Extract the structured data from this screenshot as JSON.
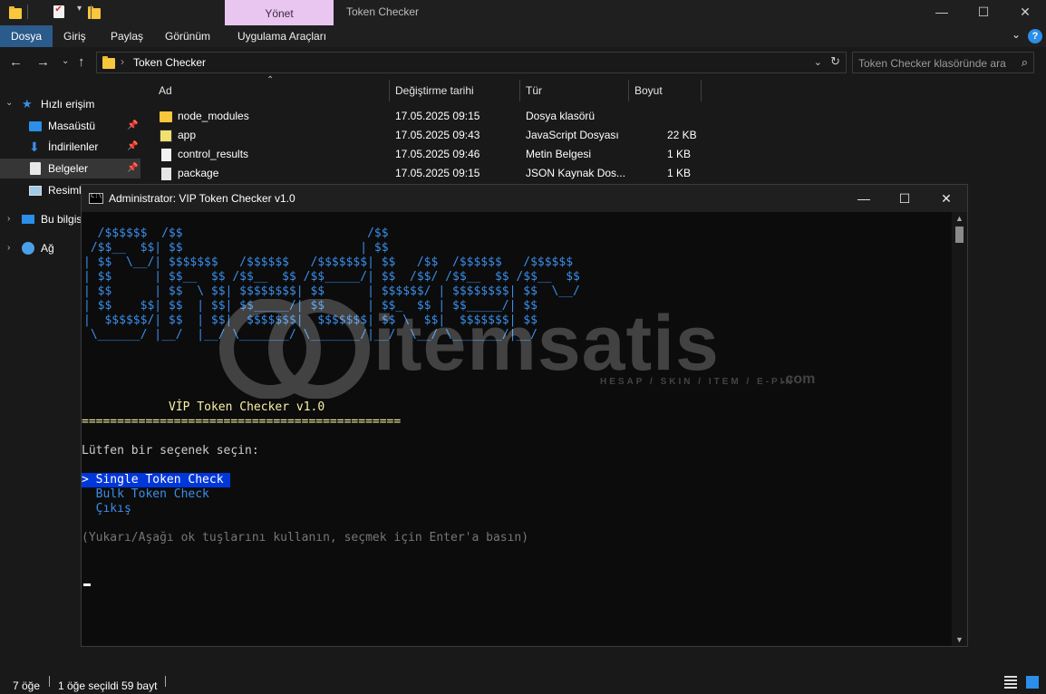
{
  "titlebar": {
    "manage_tab": "Yönet",
    "window_title": "Token Checker",
    "controls": [
      "—",
      "☐",
      "✕"
    ]
  },
  "ribbon": {
    "tabs": [
      "Dosya",
      "Giriş",
      "Paylaş",
      "Görünüm",
      "Uygulama Araçları"
    ],
    "help": "?"
  },
  "address": {
    "path": "Token Checker",
    "search_placeholder": "Token Checker klasöründe ara"
  },
  "sidebar": {
    "items": [
      {
        "label": "Hızlı erişim",
        "icon": "star-icon"
      },
      {
        "label": "Masaüstü",
        "icon": "desktop-icon",
        "pinned": true
      },
      {
        "label": "İndirilenler",
        "icon": "download-icon",
        "pinned": true
      },
      {
        "label": "Belgeler",
        "icon": "documents-icon",
        "pinned": true,
        "selected": true
      },
      {
        "label": "Resiml",
        "icon": "pictures-icon"
      },
      {
        "label": "Bu bilgis",
        "icon": "computer-icon"
      },
      {
        "label": "Ağ",
        "icon": "network-icon"
      }
    ]
  },
  "file_list": {
    "columns": [
      "Ad",
      "Değiştirme tarihi",
      "Tür",
      "Boyut"
    ],
    "rows": [
      {
        "name": "node_modules",
        "date": "17.05.2025 09:15",
        "type": "Dosya klasörü",
        "size": "",
        "icon": "folder-icon"
      },
      {
        "name": "app",
        "date": "17.05.2025 09:43",
        "type": "JavaScript Dosyası",
        "size": "22 KB",
        "icon": "js-file-icon"
      },
      {
        "name": "control_results",
        "date": "17.05.2025 09:46",
        "type": "Metin Belgesi",
        "size": "1 KB",
        "icon": "text-file-icon"
      },
      {
        "name": "package",
        "date": "17.05.2025 09:15",
        "type": "JSON Kaynak Dos...",
        "size": "1 KB",
        "icon": "json-file-icon"
      }
    ]
  },
  "console": {
    "title": "Administrator:  VIP Token Checker v1.0",
    "ascii_art": "  /$$$$$$  /$$                          /$$\n /$$__  $$| $$                         | $$\n| $$  \\__/| $$$$$$$   /$$$$$$   /$$$$$$$| $$   /$$  /$$$$$$   /$$$$$$\n| $$      | $$__  $$ /$$__  $$ /$$_____/| $$  /$$/ /$$__  $$ /$$__  $$\n| $$      | $$  \\ $$| $$$$$$$$| $$      | $$$$$$/ | $$$$$$$$| $$  \\__/\n| $$    $$| $$  | $$| $$_____/| $$      | $$_  $$ | $$_____/| $$\n|  $$$$$$/| $$  | $$|  $$$$$$$|  $$$$$$$| $$ \\  $$|  $$$$$$$| $$\n \\______/ |__/  |__/ \\_______/ \\_______/|__/  \\__/ \\_______/|__/",
    "heading": "VİP Token Checker v1.0",
    "divider": "=============================================",
    "prompt": "Lütfen bir seçenek seçin:",
    "menu": [
      "> Single Token Check ",
      "  Bulk Token Check",
      "  Çıkış"
    ],
    "hint": "(Yukarı/Aşağı ok tuşlarını kullanın, seçmek için Enter'a basın)"
  },
  "watermark": {
    "brand": "itemsatis",
    "tagline": "HESAP / SKIN / ITEM / E-PIN",
    "suffix": ".com"
  },
  "statusbar": {
    "item_count": "7 öğe",
    "selection": "1 öğe seçildi  59 bayt"
  }
}
